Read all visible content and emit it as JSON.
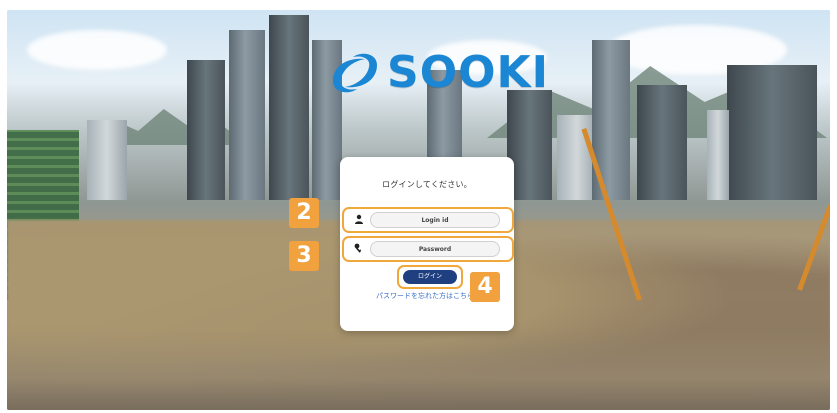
{
  "brand": {
    "name": "SOOKI",
    "color": "#1b86d3"
  },
  "login": {
    "prompt": "ログインしてください。",
    "login_id_placeholder": "Login id",
    "password_placeholder": "Password",
    "submit_label": "ログイン",
    "forgot_link": "パスワードを忘れた方はこちら"
  },
  "badges": {
    "id_step": "2",
    "password_step": "3",
    "submit_step": "4"
  },
  "colors": {
    "highlight": "#f0a73c",
    "badge": "#f1a13d",
    "button": "#1f3f80",
    "link": "#3b6fc7"
  },
  "icons": {
    "login_id": "user-icon",
    "password": "key-icon"
  }
}
